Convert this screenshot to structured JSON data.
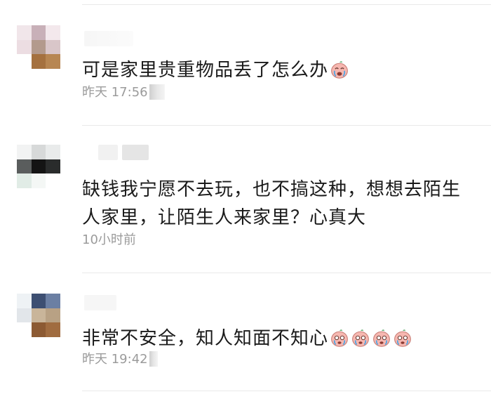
{
  "comments": [
    {
      "text": "可是家里贵重物品丢了怎么办",
      "emoji_count": 1,
      "emoji_name": "crying-face-emoji",
      "time": "昨天 17:56"
    },
    {
      "text": "缺钱我宁愿不去玩，也不搞这种，想想去陌生人家里，让陌生人来家里？心真大",
      "emoji_count": 0,
      "emoji_name": "",
      "time": "10小时前"
    },
    {
      "text": "非常不安全，知人知面不知心",
      "emoji_count": 4,
      "emoji_name": "crying-face-emoji",
      "time": "昨天 19:42"
    }
  ],
  "colors": {
    "text": "#1a1a1a",
    "meta": "#9b9b9b",
    "divider": "#e9e9e9"
  }
}
